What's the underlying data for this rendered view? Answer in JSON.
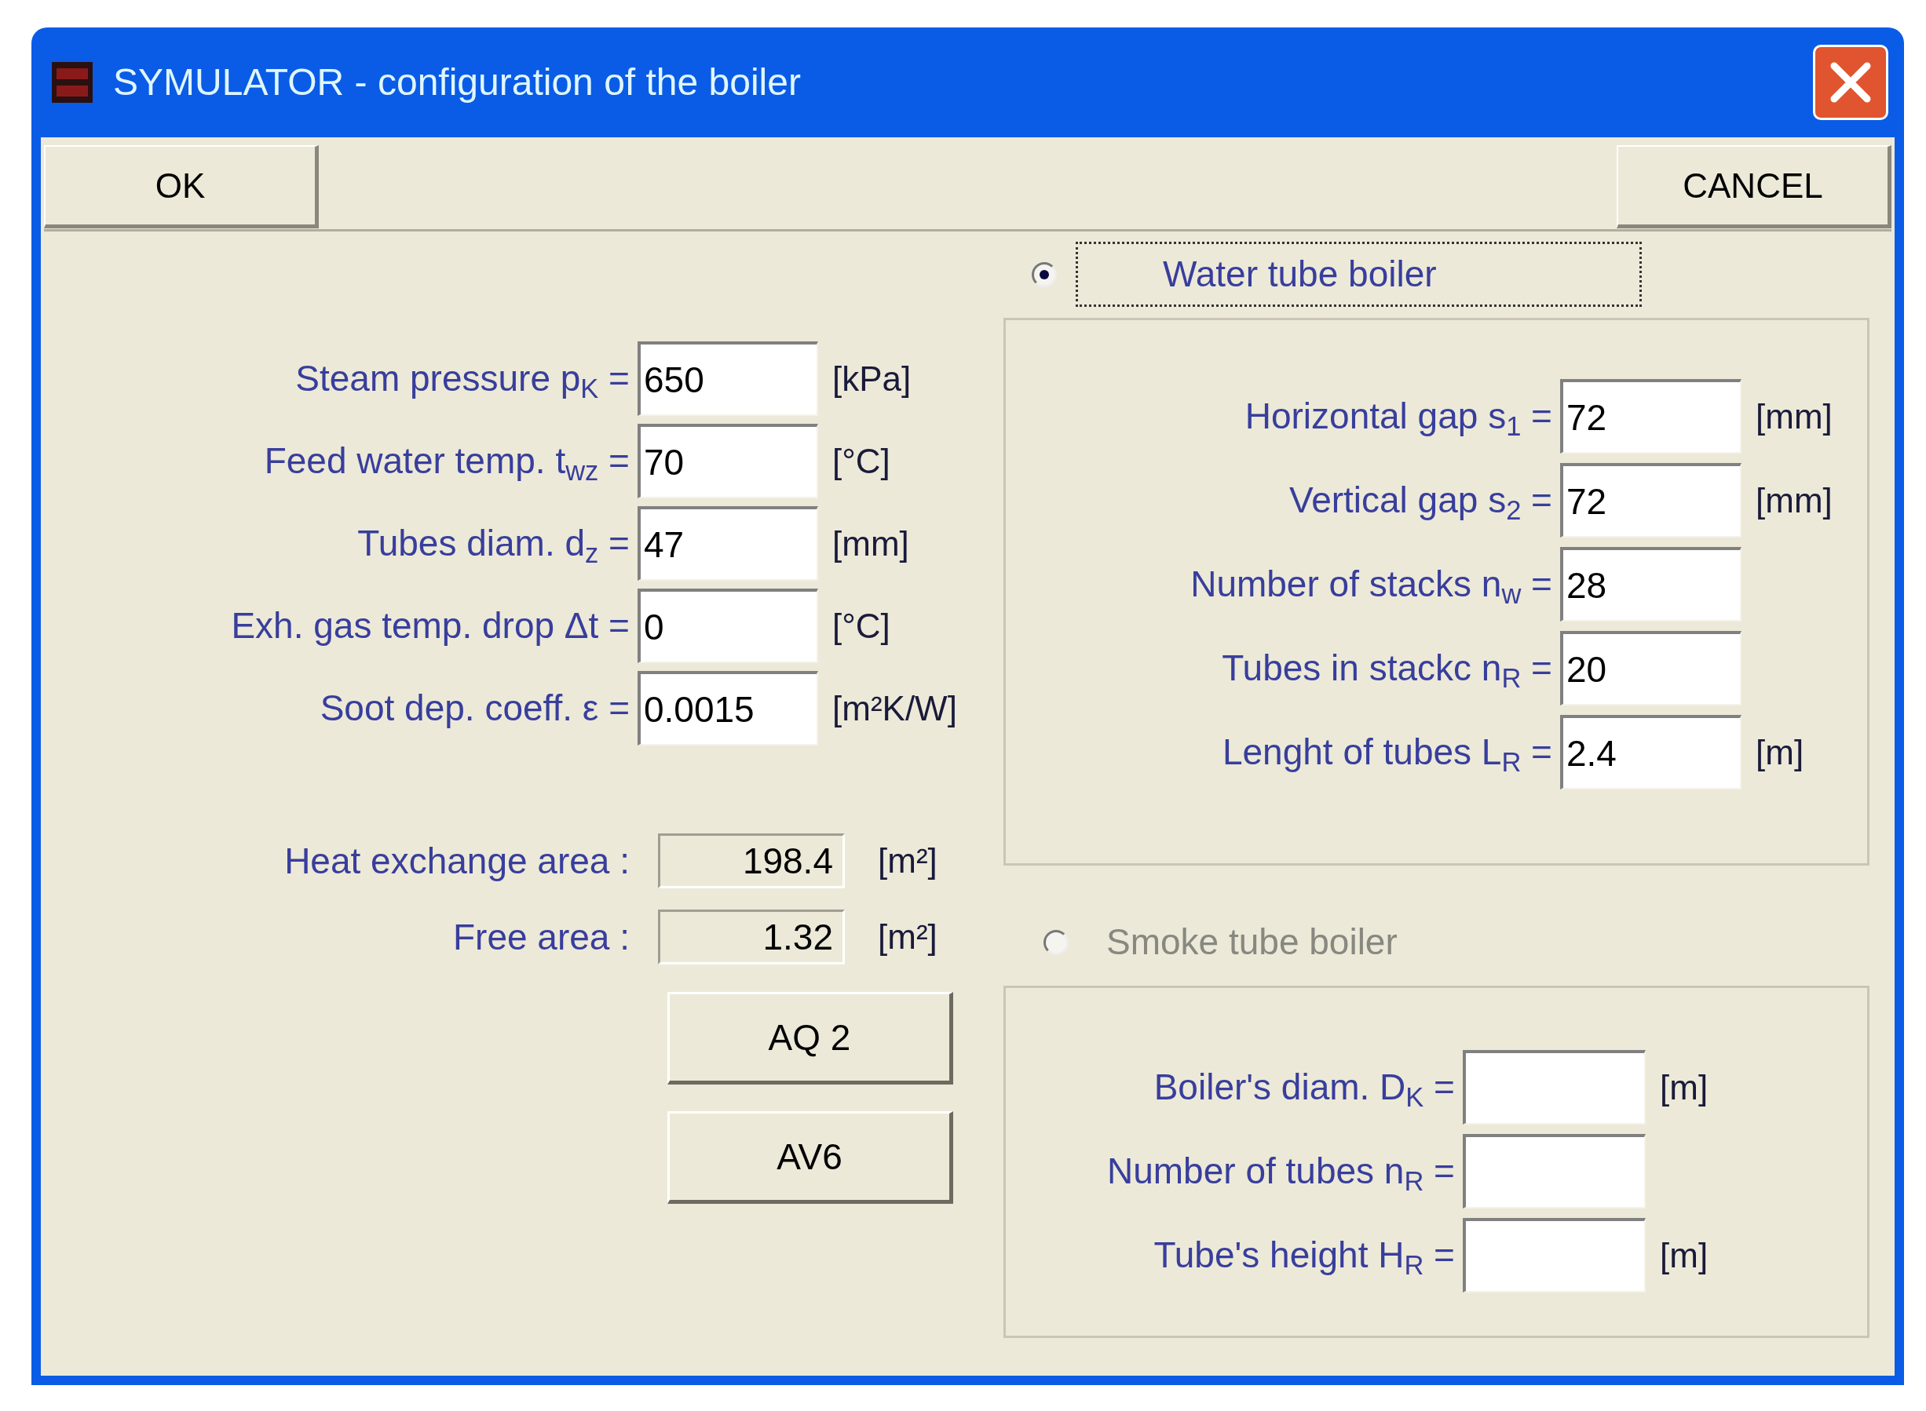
{
  "window": {
    "title": "SYMULATOR - configuration of the boiler"
  },
  "toolbar": [
    "OK",
    "CANCEL"
  ],
  "boiler_parameters": [
    {
      "label": "Steam pressure p$_{K}$ =",
      "value": "650",
      "unit": "[kPa]"
    },
    {
      "label": "Feed water temp. t$_{wz}$ =",
      "value": "70",
      "unit": "[°C]"
    },
    {
      "label": "Tubes diam. d$_{z}$ =",
      "value": "47",
      "unit": "[mm]"
    },
    {
      "label": "Exh. gas temp. drop  Δt =",
      "value": "0",
      "unit": "[°C]"
    },
    {
      "label": "Soot dep. coeff. ε =",
      "value": "0.0015",
      "unit": "[m²K/W]"
    }
  ],
  "results": [
    {
      "label": "Heat exchange area :",
      "value": "198.4",
      "unit": "[m²]"
    },
    {
      "label": "Free area :",
      "value": "1.32",
      "unit": "[m²]"
    }
  ],
  "buttons": [
    "AQ 2",
    "AV6"
  ],
  "boiler_types": [
    {
      "label": "Water tube boiler",
      "selected": true,
      "focused": true,
      "disabled": false,
      "fields": [
        {
          "label": "Horizontal gap s$_{1}$ =",
          "value": "72",
          "unit": "[mm]"
        },
        {
          "label": "Vertical gap s$_{2}$ =",
          "value": "72",
          "unit": "[mm]"
        },
        {
          "label": "Number of stacks n$_{w}$ =",
          "value": "28"
        },
        {
          "label": "Tubes in stackc n$_{R}$ =",
          "value": "20"
        },
        {
          "label": "Lenght of tubes L$_{R}$ =",
          "value": "2.4",
          "unit": "[m]"
        }
      ]
    },
    {
      "label": "Smoke tube boiler",
      "selected": false,
      "focused": false,
      "disabled": true,
      "fields": [
        {
          "label": "Boiler's diam. D$_{K}$ =",
          "unit": "[m]"
        },
        {
          "label": "Number of tubes n$_{R}$ ="
        },
        {
          "label": "Tube's height H$_{R}$ =",
          "unit": "[m]"
        }
      ]
    }
  ]
}
